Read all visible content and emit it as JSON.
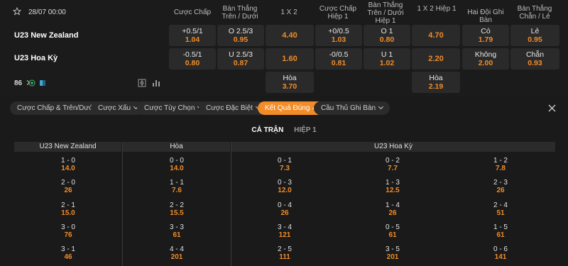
{
  "match": {
    "date_time": "28/07 00:00",
    "team1": "U23 New Zealand",
    "team2": "U23 Hoa Kỳ",
    "more_count": "86"
  },
  "headers": {
    "h1": "Cược Chấp",
    "h2": "Bàn Thắng Trên / Dưới",
    "h3": "1 X 2",
    "h4": "Cược Chấp Hiệp 1",
    "h5": "Bàn Thắng Trên / Dưới Hiệp 1",
    "h6": "1 X 2 Hiệp 1",
    "h7": "Hai Đội Ghi Bàn",
    "h8": "Bàn Thắng Chẵn / Lẻ"
  },
  "row1": {
    "c1_line": "+0.5/1",
    "c1_odd": "1.04",
    "c2_line": "O 2.5/3",
    "c2_odd": "0.95",
    "c3_odd": "4.40",
    "c4_line": "+0/0.5",
    "c4_odd": "1.03",
    "c5_line": "O 1",
    "c5_odd": "0.80",
    "c6_odd": "4.70",
    "c7_line": "Có",
    "c7_odd": "1.79",
    "c8_line": "Lẻ",
    "c8_odd": "0.95"
  },
  "row2": {
    "c1_line": "-0.5/1",
    "c1_odd": "0.80",
    "c2_line": "U 2.5/3",
    "c2_odd": "0.87",
    "c3_odd": "1.60",
    "c4_line": "-0/0.5",
    "c4_odd": "0.81",
    "c5_line": "U 1",
    "c5_odd": "1.02",
    "c6_odd": "2.20",
    "c7_line": "Không",
    "c7_odd": "2.00",
    "c8_line": "Chẵn",
    "c8_odd": "0.93"
  },
  "row3": {
    "c3_line": "Hòa",
    "c3_odd": "3.70",
    "c6_line": "Hòa",
    "c6_odd": "2.19"
  },
  "filters": [
    "Cược Chấp & Trên/Dưới",
    "Cược Xấu",
    "Cược Tùy Chọn",
    "Cược Đặc Biệt",
    "Kết Quả Đúng",
    "Cầu Thủ Ghi Bàn"
  ],
  "tabs": {
    "full": "CẢ TRẬN",
    "half": "HIỆP 1"
  },
  "cs_headers": {
    "home": "U23 New Zealand",
    "draw": "Hòa",
    "away": "U23 Hoa Kỳ"
  },
  "cs": {
    "home": [
      {
        "s": "1 - 0",
        "o": "14.0"
      },
      {
        "s": "2 - 0",
        "o": "26"
      },
      {
        "s": "2 - 1",
        "o": "15.0"
      },
      {
        "s": "3 - 0",
        "o": "76"
      },
      {
        "s": "3 - 1",
        "o": "46"
      }
    ],
    "draw": [
      {
        "s": "0 - 0",
        "o": "14.0"
      },
      {
        "s": "1 - 1",
        "o": "7.6"
      },
      {
        "s": "2 - 2",
        "o": "15.5"
      },
      {
        "s": "3 - 3",
        "o": "61"
      },
      {
        "s": "4 - 4",
        "o": "201"
      }
    ],
    "away1": [
      {
        "s": "0 - 1",
        "o": "7.3"
      },
      {
        "s": "0 - 3",
        "o": "12.0"
      },
      {
        "s": "0 - 4",
        "o": "26"
      },
      {
        "s": "3 - 4",
        "o": "121"
      },
      {
        "s": "2 - 5",
        "o": "111"
      }
    ],
    "away2": [
      {
        "s": "0 - 2",
        "o": "7.7"
      },
      {
        "s": "1 - 3",
        "o": "12.5"
      },
      {
        "s": "1 - 4",
        "o": "26"
      },
      {
        "s": "0 - 5",
        "o": "61"
      },
      {
        "s": "3 - 5",
        "o": "201"
      }
    ],
    "away3": [
      {
        "s": "1 - 2",
        "o": "7.8"
      },
      {
        "s": "2 - 3",
        "o": "26"
      },
      {
        "s": "2 - 4",
        "o": "51"
      },
      {
        "s": "1 - 5",
        "o": "61"
      },
      {
        "s": "0 - 6",
        "o": "141"
      }
    ]
  },
  "colors": {
    "accent": "#f28c28",
    "bg": "#1a1a1a",
    "cell": "#2a2a2a"
  }
}
